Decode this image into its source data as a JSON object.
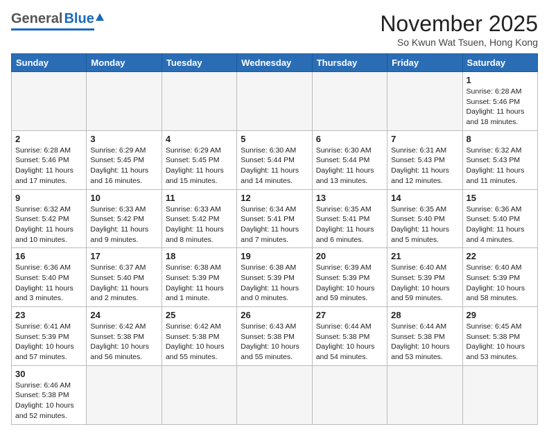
{
  "header": {
    "logo_general": "General",
    "logo_blue": "Blue",
    "month_year": "November 2025",
    "location": "So Kwun Wat Tsuen, Hong Kong"
  },
  "weekdays": [
    "Sunday",
    "Monday",
    "Tuesday",
    "Wednesday",
    "Thursday",
    "Friday",
    "Saturday"
  ],
  "weeks": [
    [
      {
        "day": "",
        "info": ""
      },
      {
        "day": "",
        "info": ""
      },
      {
        "day": "",
        "info": ""
      },
      {
        "day": "",
        "info": ""
      },
      {
        "day": "",
        "info": ""
      },
      {
        "day": "",
        "info": ""
      },
      {
        "day": "1",
        "info": "Sunrise: 6:28 AM\nSunset: 5:46 PM\nDaylight: 11 hours and 18 minutes."
      }
    ],
    [
      {
        "day": "2",
        "info": "Sunrise: 6:28 AM\nSunset: 5:46 PM\nDaylight: 11 hours and 17 minutes."
      },
      {
        "day": "3",
        "info": "Sunrise: 6:29 AM\nSunset: 5:45 PM\nDaylight: 11 hours and 16 minutes."
      },
      {
        "day": "4",
        "info": "Sunrise: 6:29 AM\nSunset: 5:45 PM\nDaylight: 11 hours and 15 minutes."
      },
      {
        "day": "5",
        "info": "Sunrise: 6:30 AM\nSunset: 5:44 PM\nDaylight: 11 hours and 14 minutes."
      },
      {
        "day": "6",
        "info": "Sunrise: 6:30 AM\nSunset: 5:44 PM\nDaylight: 11 hours and 13 minutes."
      },
      {
        "day": "7",
        "info": "Sunrise: 6:31 AM\nSunset: 5:43 PM\nDaylight: 11 hours and 12 minutes."
      },
      {
        "day": "8",
        "info": "Sunrise: 6:32 AM\nSunset: 5:43 PM\nDaylight: 11 hours and 11 minutes."
      }
    ],
    [
      {
        "day": "9",
        "info": "Sunrise: 6:32 AM\nSunset: 5:42 PM\nDaylight: 11 hours and 10 minutes."
      },
      {
        "day": "10",
        "info": "Sunrise: 6:33 AM\nSunset: 5:42 PM\nDaylight: 11 hours and 9 minutes."
      },
      {
        "day": "11",
        "info": "Sunrise: 6:33 AM\nSunset: 5:42 PM\nDaylight: 11 hours and 8 minutes."
      },
      {
        "day": "12",
        "info": "Sunrise: 6:34 AM\nSunset: 5:41 PM\nDaylight: 11 hours and 7 minutes."
      },
      {
        "day": "13",
        "info": "Sunrise: 6:35 AM\nSunset: 5:41 PM\nDaylight: 11 hours and 6 minutes."
      },
      {
        "day": "14",
        "info": "Sunrise: 6:35 AM\nSunset: 5:40 PM\nDaylight: 11 hours and 5 minutes."
      },
      {
        "day": "15",
        "info": "Sunrise: 6:36 AM\nSunset: 5:40 PM\nDaylight: 11 hours and 4 minutes."
      }
    ],
    [
      {
        "day": "16",
        "info": "Sunrise: 6:36 AM\nSunset: 5:40 PM\nDaylight: 11 hours and 3 minutes."
      },
      {
        "day": "17",
        "info": "Sunrise: 6:37 AM\nSunset: 5:40 PM\nDaylight: 11 hours and 2 minutes."
      },
      {
        "day": "18",
        "info": "Sunrise: 6:38 AM\nSunset: 5:39 PM\nDaylight: 11 hours and 1 minute."
      },
      {
        "day": "19",
        "info": "Sunrise: 6:38 AM\nSunset: 5:39 PM\nDaylight: 11 hours and 0 minutes."
      },
      {
        "day": "20",
        "info": "Sunrise: 6:39 AM\nSunset: 5:39 PM\nDaylight: 10 hours and 59 minutes."
      },
      {
        "day": "21",
        "info": "Sunrise: 6:40 AM\nSunset: 5:39 PM\nDaylight: 10 hours and 59 minutes."
      },
      {
        "day": "22",
        "info": "Sunrise: 6:40 AM\nSunset: 5:39 PM\nDaylight: 10 hours and 58 minutes."
      }
    ],
    [
      {
        "day": "23",
        "info": "Sunrise: 6:41 AM\nSunset: 5:39 PM\nDaylight: 10 hours and 57 minutes."
      },
      {
        "day": "24",
        "info": "Sunrise: 6:42 AM\nSunset: 5:38 PM\nDaylight: 10 hours and 56 minutes."
      },
      {
        "day": "25",
        "info": "Sunrise: 6:42 AM\nSunset: 5:38 PM\nDaylight: 10 hours and 55 minutes."
      },
      {
        "day": "26",
        "info": "Sunrise: 6:43 AM\nSunset: 5:38 PM\nDaylight: 10 hours and 55 minutes."
      },
      {
        "day": "27",
        "info": "Sunrise: 6:44 AM\nSunset: 5:38 PM\nDaylight: 10 hours and 54 minutes."
      },
      {
        "day": "28",
        "info": "Sunrise: 6:44 AM\nSunset: 5:38 PM\nDaylight: 10 hours and 53 minutes."
      },
      {
        "day": "29",
        "info": "Sunrise: 6:45 AM\nSunset: 5:38 PM\nDaylight: 10 hours and 53 minutes."
      }
    ],
    [
      {
        "day": "30",
        "info": "Sunrise: 6:46 AM\nSunset: 5:38 PM\nDaylight: 10 hours and 52 minutes."
      },
      {
        "day": "",
        "info": ""
      },
      {
        "day": "",
        "info": ""
      },
      {
        "day": "",
        "info": ""
      },
      {
        "day": "",
        "info": ""
      },
      {
        "day": "",
        "info": ""
      },
      {
        "day": "",
        "info": ""
      }
    ]
  ]
}
